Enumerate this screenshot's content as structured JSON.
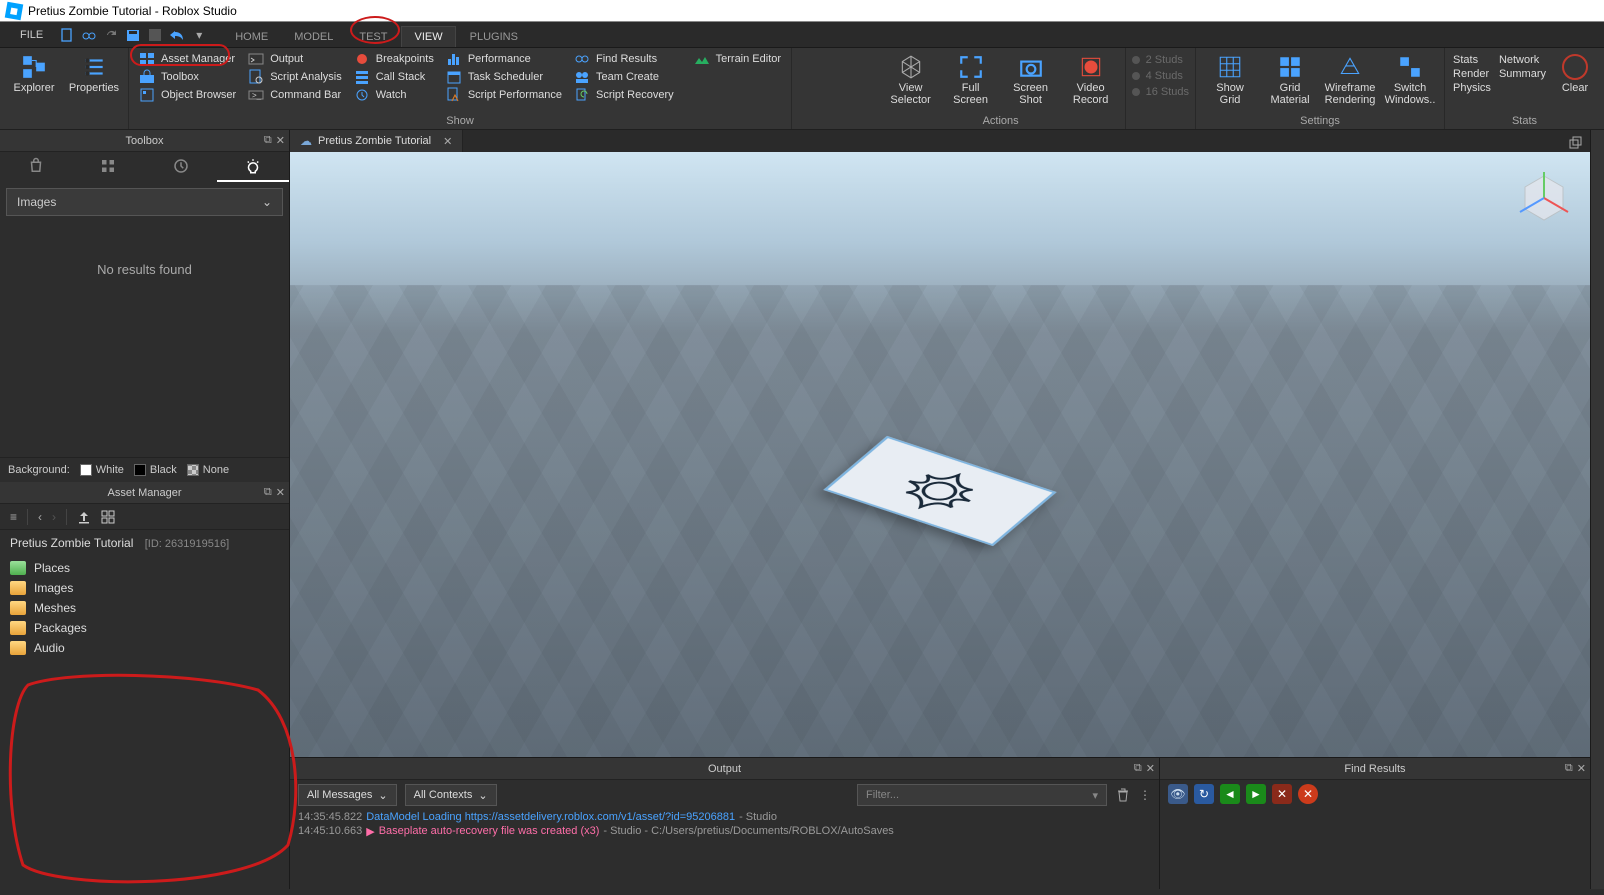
{
  "title": "Pretius Zombie Tutorial - Roblox Studio",
  "menu": {
    "file": "FILE",
    "tabs": [
      "HOME",
      "MODEL",
      "TEST",
      "VIEW",
      "PLUGINS"
    ],
    "active": "VIEW"
  },
  "ribbon": {
    "explorer": "Explorer",
    "properties": "Properties",
    "col1": {
      "asset_manager": "Asset Manager",
      "toolbox": "Toolbox",
      "object_browser": "Object Browser"
    },
    "col2": {
      "output": "Output",
      "script_analysis": "Script Analysis",
      "command_bar": "Command Bar"
    },
    "col3": {
      "breakpoints": "Breakpoints",
      "call_stack": "Call Stack",
      "watch": "Watch"
    },
    "col4": {
      "performance": "Performance",
      "task_scheduler": "Task Scheduler",
      "script_performance": "Script Performance"
    },
    "col5": {
      "find_results": "Find Results",
      "team_create": "Team Create",
      "script_recovery": "Script Recovery"
    },
    "terrain": "Terrain Editor",
    "show_label": "Show",
    "actions": {
      "view_selector": "View\nSelector",
      "full_screen": "Full\nScreen",
      "screen_shot": "Screen\nShot",
      "video_record": "Video\nRecord",
      "label": "Actions"
    },
    "studs": {
      "s2": "2 Studs",
      "s4": "4 Studs",
      "s16": "16 Studs"
    },
    "settings": {
      "show_grid": "Show\nGrid",
      "grid_material": "Grid\nMaterial",
      "wireframe": "Wireframe\nRendering",
      "switch_windows": "Switch\nWindows..",
      "label": "Settings"
    },
    "stats": {
      "stats": "Stats",
      "render": "Render",
      "physics": "Physics",
      "network": "Network",
      "summary": "Summary",
      "clear": "Clear",
      "label": "Stats"
    }
  },
  "toolbox": {
    "title": "Toolbox",
    "dropdown": "Images",
    "noresults": "No results found",
    "bg_label": "Background:",
    "bg_white": "White",
    "bg_black": "Black",
    "bg_none": "None"
  },
  "asset_manager": {
    "title": "Asset Manager",
    "project": "Pretius Zombie Tutorial",
    "id_label": "[ID: 2631919516]",
    "folders": [
      "Places",
      "Images",
      "Meshes",
      "Packages",
      "Audio"
    ]
  },
  "doc_tab": {
    "label": "Pretius Zombie Tutorial"
  },
  "output": {
    "title": "Output",
    "all_messages": "All Messages",
    "all_contexts": "All Contexts",
    "filter_ph": "Filter...",
    "log1": {
      "ts": "14:35:45.822",
      "msg": "DataModel Loading https://assetdelivery.roblox.com/v1/asset/?id=95206881",
      "tail": " - Studio"
    },
    "log2": {
      "ts": "14:45:10.663",
      "tri": "▶",
      "msg": "Baseplate auto-recovery file was created (x3)",
      "tail": " - Studio - C:/Users/pretius/Documents/ROBLOX/AutoSaves"
    }
  },
  "find": {
    "title": "Find Results"
  }
}
